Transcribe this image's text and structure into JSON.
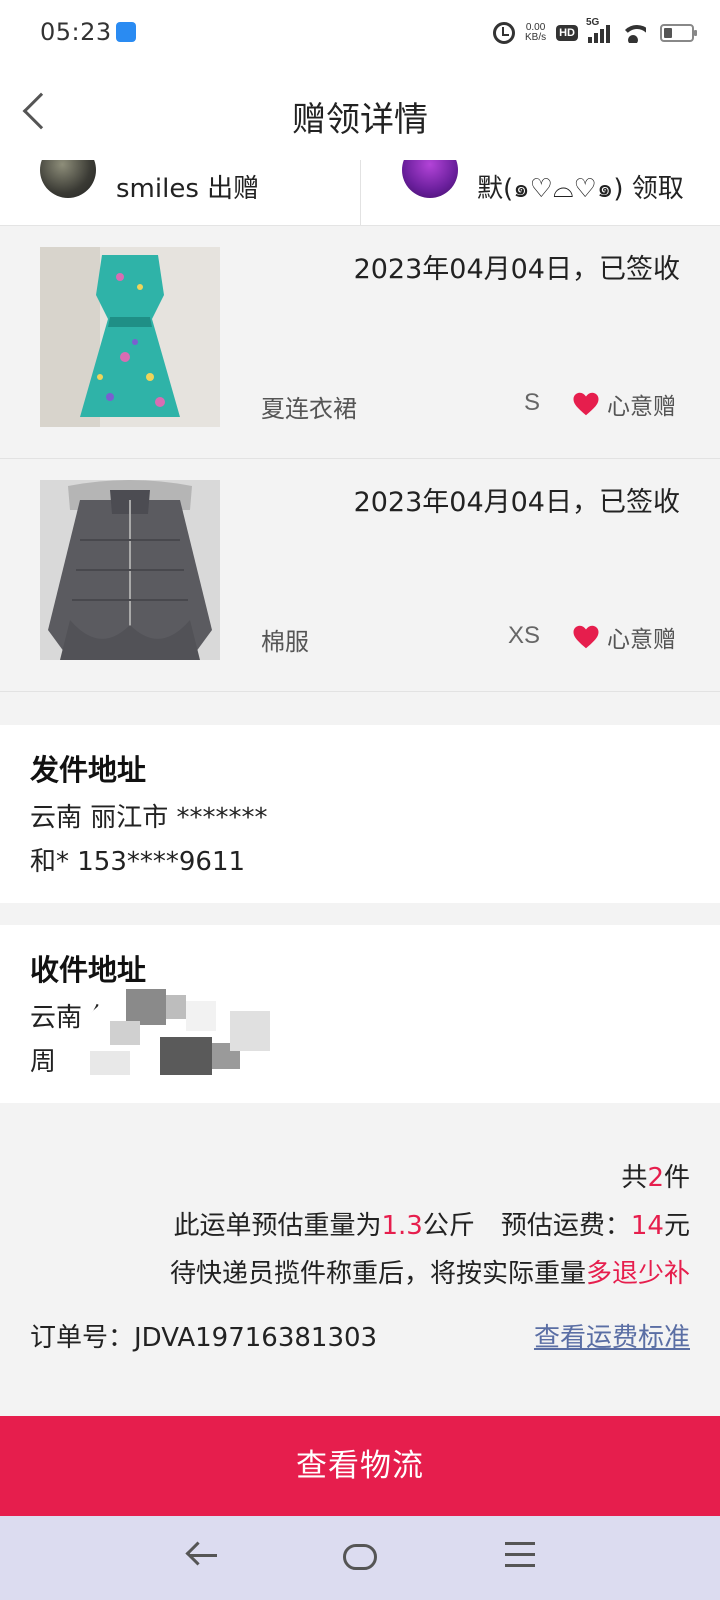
{
  "status_bar": {
    "time": "05:23",
    "net_speed_value": "0.00",
    "net_speed_unit": "KB/s",
    "hd_label": "HD",
    "network_label": "5G",
    "icons": [
      "app-icon",
      "alarm-icon",
      "signal-icon",
      "wifi-icon",
      "battery-icon"
    ]
  },
  "header": {
    "title": "赠领详情",
    "back_icon": "chevron-left-icon"
  },
  "users": {
    "giver_name": "smiles",
    "giver_action": "出赠",
    "receiver_name": "默(๑♡⌓♡๑)",
    "receiver_action": "领取"
  },
  "items": [
    {
      "date_status": "2023年04月04日，已签收",
      "name": "夏连衣裙",
      "size": "S",
      "tag": "心意赠"
    },
    {
      "date_status": "2023年04月04日，已签收",
      "name": "棉服",
      "size": "XS",
      "tag": "心意赠"
    }
  ],
  "sender_address": {
    "title": "发件地址",
    "line1": "云南 丽江市 *******",
    "line2": "和* 153****9611"
  },
  "receiver_address": {
    "title": "收件地址",
    "line1_visible": "云南 红",
    "line2_visible": "周"
  },
  "summary": {
    "count_prefix": "共",
    "count_value": "2",
    "count_suffix": "件",
    "weight_prefix": "此运单预估重量为",
    "weight_value": "1.3",
    "weight_unit": "公斤",
    "fee_prefix": "预估运费：",
    "fee_value": "14",
    "fee_unit": "元",
    "note_prefix": "待快递员揽件称重后，将按实际重量",
    "note_accent": "多退少补",
    "order_label": "订单号：JDVA19716381303",
    "fee_standard_link": "查看运费标准"
  },
  "actions": {
    "logistics_button": "查看物流"
  },
  "colors": {
    "accent": "#e61e4d",
    "link": "#5a6ea4",
    "background": "#f3f3f3",
    "nav_bar": "#dcdcf0"
  }
}
